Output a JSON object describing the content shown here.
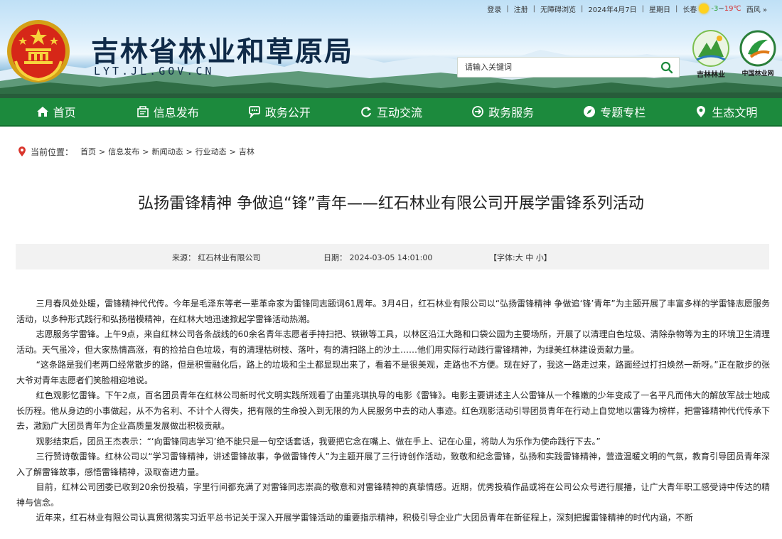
{
  "topbar": {
    "login": "登录",
    "register": "注册",
    "accessible": "无障碍浏览",
    "date": "2024年4月7日",
    "weekday": "星期日",
    "city": "长春",
    "temp_low": "-3",
    "temp_range_sep": "~",
    "temp_high": "19℃",
    "wind": "西风 »"
  },
  "header": {
    "site_title": "吉林省林业和草原局",
    "site_domain": "LYT.JL.GOV.CN",
    "search_placeholder": "请输入关键词",
    "logo_jl_caption": "吉林林业",
    "logo_cn_caption": "中国林业网"
  },
  "nav": {
    "items": [
      {
        "label": "首页",
        "icon": "home-icon"
      },
      {
        "label": "信息发布",
        "icon": "info-release-icon"
      },
      {
        "label": "政务公开",
        "icon": "chat-icon"
      },
      {
        "label": "互动交流",
        "icon": "refresh-icon"
      },
      {
        "label": "政务服务",
        "icon": "service-icon"
      },
      {
        "label": "专题专栏",
        "icon": "compass-icon"
      },
      {
        "label": "生态文明",
        "icon": "location-icon"
      }
    ]
  },
  "breadcrumb": {
    "label": "当前位置：",
    "items": [
      "首页",
      "信息发布",
      "新闻动态",
      "行业动态",
      "吉林"
    ]
  },
  "article": {
    "title": "弘扬雷锋精神 争做追“锋”青年——红石林业有限公司开展学雷锋系列活动",
    "source_label": "来源：",
    "source": "红石林业有限公司",
    "date_label": "日期：",
    "date": "2024-03-05 14:01:00",
    "font_label_prefix": "【字体:",
    "font_large": "大",
    "font_medium": "中",
    "font_small": "小",
    "font_label_suffix": "】",
    "paragraphs": [
      "三月春风处处暖，雷锋精神代代传。今年是毛泽东等老一辈革命家为雷锋同志题词61周年。3月4日，红石林业有限公司以“弘扬雷锋精神 争做追‘锋’青年”为主题开展了丰富多样的学雷锋志愿服务活动，以多种形式践行和弘扬楷模精神，在红林大地迅速掀起学雷锋活动热潮。",
      "志愿服务学雷锋。上午9点，来自红林公司各条战线的60余名青年志愿者手持扫把、铁锹等工具，以林区沿江大路和口袋公园为主要场所，开展了以清理白色垃圾、清除杂物等为主的环境卫生清理活动。天气虽冷，但大家热情高涨，有的捡拾白色垃圾，有的清理枯树枝、落叶，有的清扫路上的沙土……他们用实际行动践行雷锋精神，为绿美红林建设贡献力量。",
      "“这条路是我们老两口经常散步的路，但是积雪融化后，路上的垃圾和尘土都显现出来了，看着不是很美观，走路也不方便。现在好了，我这一路走过来，路面经过打扫焕然一新呀。”正在散步的张大爷对青年志愿者们笑脸相迎地说。",
      "红色观影忆雷锋。下午2点，百名团员青年在红林公司新时代文明实践所观看了由董兆琪执导的电影《雷锋》。电影主要讲述主人公雷锋从一个稚嫩的少年变成了一名平凡而伟大的解放军战士地成长历程。他从身边的小事做起，从不为名利、不计个人得失，把有限的生命投入到无限的为人民服务中去的动人事迹。红色观影活动引导团员青年在行动上自觉地以雷锋为榜样，把雷锋精神代代传承下去，激励广大团员青年为企业高质量发展做出积极贡献。",
      "观影结束后，团员王杰表示：“‘向雷锋同志学习’绝不能只是一句空话套话，我要把它念在嘴上、做在手上、记在心里，将助人为乐作为使命践行下去。”",
      "三行赞诗敬雷锋。红林公司以“学习雷锋精神，讲述雷锋故事，争做雷锋传人”为主题开展了三行诗创作活动，致敬和纪念雷锋，弘扬和实践雷锋精神，营造温暖文明的气氛，教育引导团员青年深入了解雷锋故事，感悟雷锋精神，汲取奋进力量。",
      "目前，红林公司团委已收到20余份投稿，字里行间都充满了对雷锋同志崇高的敬意和对雷锋精神的真挚情感。近期，优秀投稿作品或将在公司公众号进行展播，让广大青年职工感受诗中传达的精神与信念。",
      "近年来，红石林业有限公司认真贯彻落实习近平总书记关于深入开展学雷锋活动的重要指示精神，积极引导企业广大团员青年在新征程上，深刻把握雷锋精神的时代内涵，不断"
    ]
  },
  "colors": {
    "nav_green": "#1c8a3d",
    "title_navy": "#0f2a48",
    "breadcrumb_pin": "#d9342b"
  }
}
